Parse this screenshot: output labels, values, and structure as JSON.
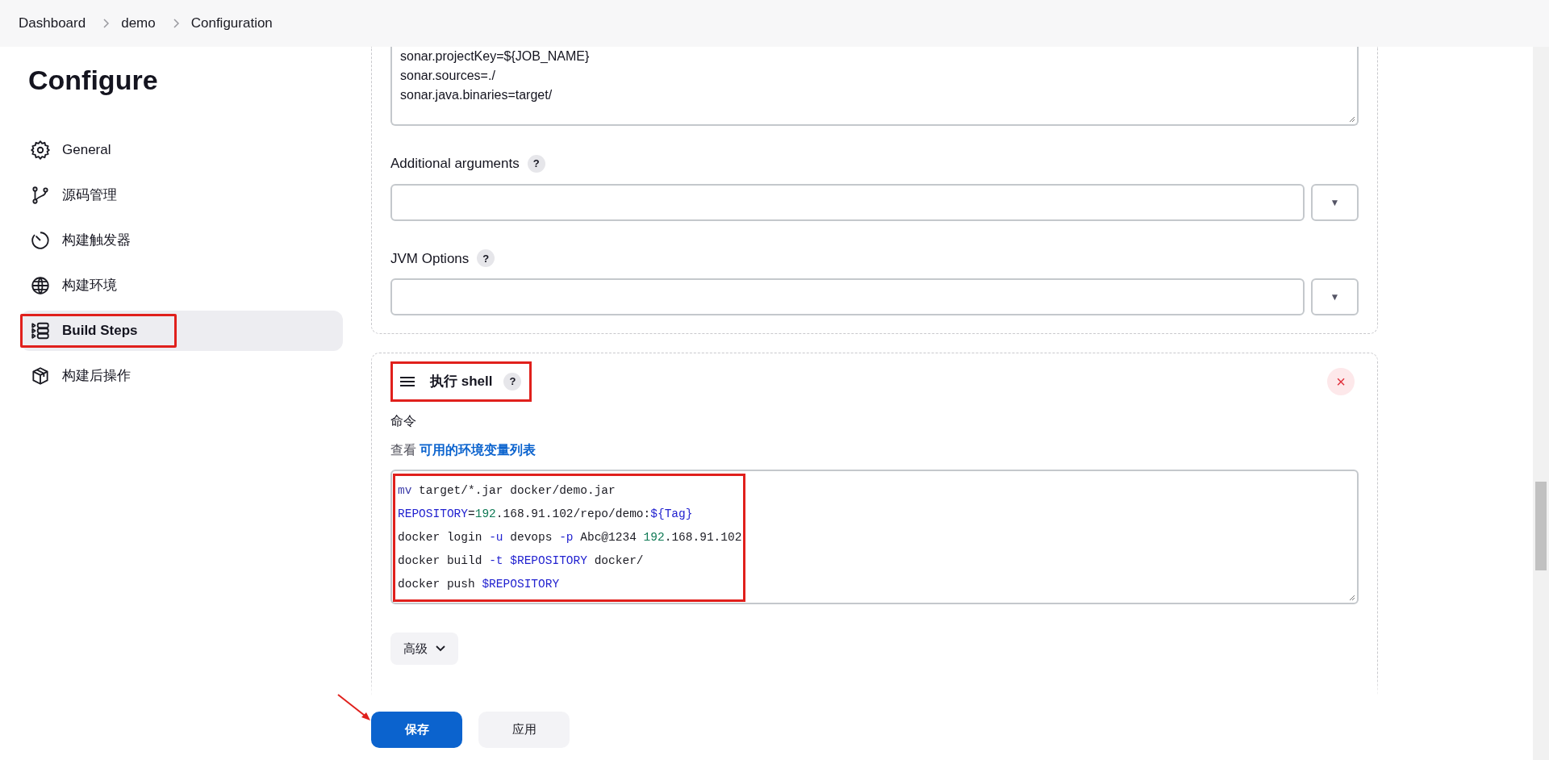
{
  "breadcrumb": [
    {
      "label": "Dashboard"
    },
    {
      "label": "demo"
    },
    {
      "label": "Configuration"
    }
  ],
  "page_title": "Configure",
  "sidebar": {
    "items": [
      {
        "label": "General",
        "kind": "gear",
        "selected": false,
        "highlighted": false
      },
      {
        "label": "源码管理",
        "kind": "branch",
        "selected": false,
        "highlighted": false
      },
      {
        "label": "构建触发器",
        "kind": "timer",
        "selected": false,
        "highlighted": false
      },
      {
        "label": "构建环境",
        "kind": "globe",
        "selected": false,
        "highlighted": false
      },
      {
        "label": "Build Steps",
        "kind": "steps",
        "selected": true,
        "highlighted": true
      },
      {
        "label": "构建后操作",
        "kind": "package",
        "selected": false,
        "highlighted": false
      }
    ]
  },
  "sonar_section": {
    "properties_lines": [
      "sonar.projectKey=${JOB_NAME}",
      "sonar.sources=./",
      "sonar.java.binaries=target/"
    ],
    "fields": [
      {
        "label": "Additional arguments",
        "help": "?",
        "dropdown": "▼"
      },
      {
        "label": "JVM Options",
        "help": "?",
        "dropdown": "▼"
      }
    ]
  },
  "shell_step": {
    "title": "执行 shell",
    "help": "?",
    "highlighted": true,
    "delete": "×",
    "command_label": "命令",
    "env_prefix": "查看",
    "env_link": "可用的环境变量列表",
    "code_highlighted": true,
    "code": [
      [
        {
          "kind": "command",
          "text": "mv"
        },
        {
          "kind": "plain",
          "text": " target/*.jar docker/demo.jar"
        }
      ],
      [
        {
          "kind": "variable",
          "text": "REPOSITORY"
        },
        {
          "kind": "plain",
          "text": "="
        },
        {
          "kind": "number",
          "text": "192"
        },
        {
          "kind": "plain",
          "text": ".168.91.102/repo/demo:"
        },
        {
          "kind": "variable",
          "text": "${Tag}"
        }
      ],
      [
        {
          "kind": "plain",
          "text": "docker login "
        },
        {
          "kind": "flag",
          "text": "-u"
        },
        {
          "kind": "plain",
          "text": " devops "
        },
        {
          "kind": "flag",
          "text": "-p"
        },
        {
          "kind": "plain",
          "text": " Abc@1234 "
        },
        {
          "kind": "number",
          "text": "192"
        },
        {
          "kind": "plain",
          "text": ".168.91.102"
        }
      ],
      [
        {
          "kind": "plain",
          "text": "docker build "
        },
        {
          "kind": "flag",
          "text": "-t "
        },
        {
          "kind": "variable",
          "text": "$REPOSITORY"
        },
        {
          "kind": "plain",
          "text": " docker/"
        }
      ],
      [
        {
          "kind": "plain",
          "text": "docker push "
        },
        {
          "kind": "variable",
          "text": "$REPOSITORY"
        }
      ]
    ],
    "advanced": "高级"
  },
  "footer": {
    "buttons": [
      {
        "label": "保存",
        "primary": true,
        "pointed": true
      },
      {
        "label": "应用",
        "primary": false,
        "pointed": false
      }
    ]
  }
}
